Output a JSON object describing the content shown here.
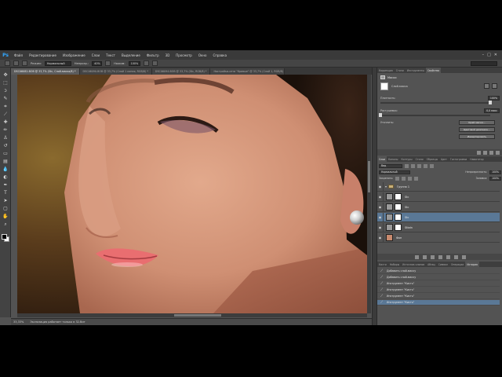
{
  "app": {
    "logo": "Ps"
  },
  "menu": [
    "Файл",
    "Редактирование",
    "Изображение",
    "Слои",
    "Текст",
    "Выделение",
    "Фильтр",
    "3D",
    "Просмотр",
    "Окно",
    "Справка"
  ],
  "window_controls": [
    "–",
    "□",
    "✕"
  ],
  "options": {
    "mode_label": "Режим:",
    "mode_value": "Нормальный",
    "opacity_label": "Непрозр.:",
    "opacity_value": "40%",
    "flow_label": "Нажим:",
    "flow_value": "100%"
  },
  "doc_tabs": [
    {
      "label": "DSC06082-ВОВ @ 33,7% (Stc, Слой-маска/8) *",
      "active": true
    },
    {
      "label": "DSC06090-ВОВ @ 33,7% (Слой 1 копия, RGB/8) *",
      "active": false
    },
    {
      "label": "DSC06094-ВОВ @ 33,7% (Stc, RGB/8) *",
      "active": false
    },
    {
      "label": "Настройки-сети \"Кривые\" @ 33,7% (Слой 1, RGB/8)",
      "active": false
    }
  ],
  "status": {
    "zoom": "33,33%",
    "doc_info": "Экспозиция работает только в 32-бит"
  },
  "props_tabs": [
    {
      "label": "Коррекция",
      "active": false
    },
    {
      "label": "Стили",
      "active": false
    },
    {
      "label": "Инструменты",
      "active": false
    },
    {
      "label": "Свойства",
      "active": true
    }
  ],
  "properties": {
    "title": "Маски",
    "mask_kind": "Слой-маска",
    "density_label": "Плотность:",
    "density_value": "100%",
    "feather_label": "Растушевка:",
    "feather_value": "0,0 пикс",
    "refine_label": "Уточнить:",
    "buttons": [
      "Край маски...",
      "Цветовой диапазон...",
      "Инвертировать"
    ]
  },
  "layers_tabs": [
    {
      "label": "Слои",
      "active": true
    },
    {
      "label": "Каналы",
      "active": false
    },
    {
      "label": "Контуры",
      "active": false
    },
    {
      "label": "Стили",
      "active": false
    },
    {
      "label": "Образцы",
      "active": false
    },
    {
      "label": "Цвет",
      "active": false
    },
    {
      "label": "Гистограмма",
      "active": false
    },
    {
      "label": "Навигатор",
      "active": false
    }
  ],
  "layers": {
    "filter_value": "Вид",
    "blend_value": "Нормальный",
    "opacity_label": "Непрозрачность:",
    "opacity_value": "100%",
    "lock_label": "Закрепить:",
    "fill_label": "Заливка:",
    "fill_value": "100%",
    "rows": [
      {
        "name": "Группа 1",
        "type": "group",
        "selected": false
      },
      {
        "name": "Stc",
        "type": "mask",
        "selected": false
      },
      {
        "name": "Stc",
        "type": "mask",
        "selected": false
      },
      {
        "name": "Stc",
        "type": "mask",
        "selected": true
      },
      {
        "name": "Stbdn",
        "type": "mask",
        "selected": false
      },
      {
        "name": "Фон",
        "type": "photo",
        "selected": false
      }
    ]
  },
  "history_tabs": [
    {
      "label": "Кисти",
      "active": false
    },
    {
      "label": "Наборы",
      "active": false
    },
    {
      "label": "Источник клонов",
      "active": false
    },
    {
      "label": "Абзац",
      "active": false
    },
    {
      "label": "Символ",
      "active": false
    },
    {
      "label": "Операции",
      "active": false
    },
    {
      "label": "История",
      "active": true
    }
  ],
  "history": [
    {
      "label": "Добавить слой-маску",
      "selected": false
    },
    {
      "label": "Добавить слой-маску",
      "selected": false
    },
    {
      "label": "Инструмент \"Кисть\"",
      "selected": false
    },
    {
      "label": "Инструмент \"Кисть\"",
      "selected": false
    },
    {
      "label": "Инструмент \"Кисть\"",
      "selected": false
    },
    {
      "label": "Инструмент \"Кисть\"",
      "selected": true
    }
  ]
}
